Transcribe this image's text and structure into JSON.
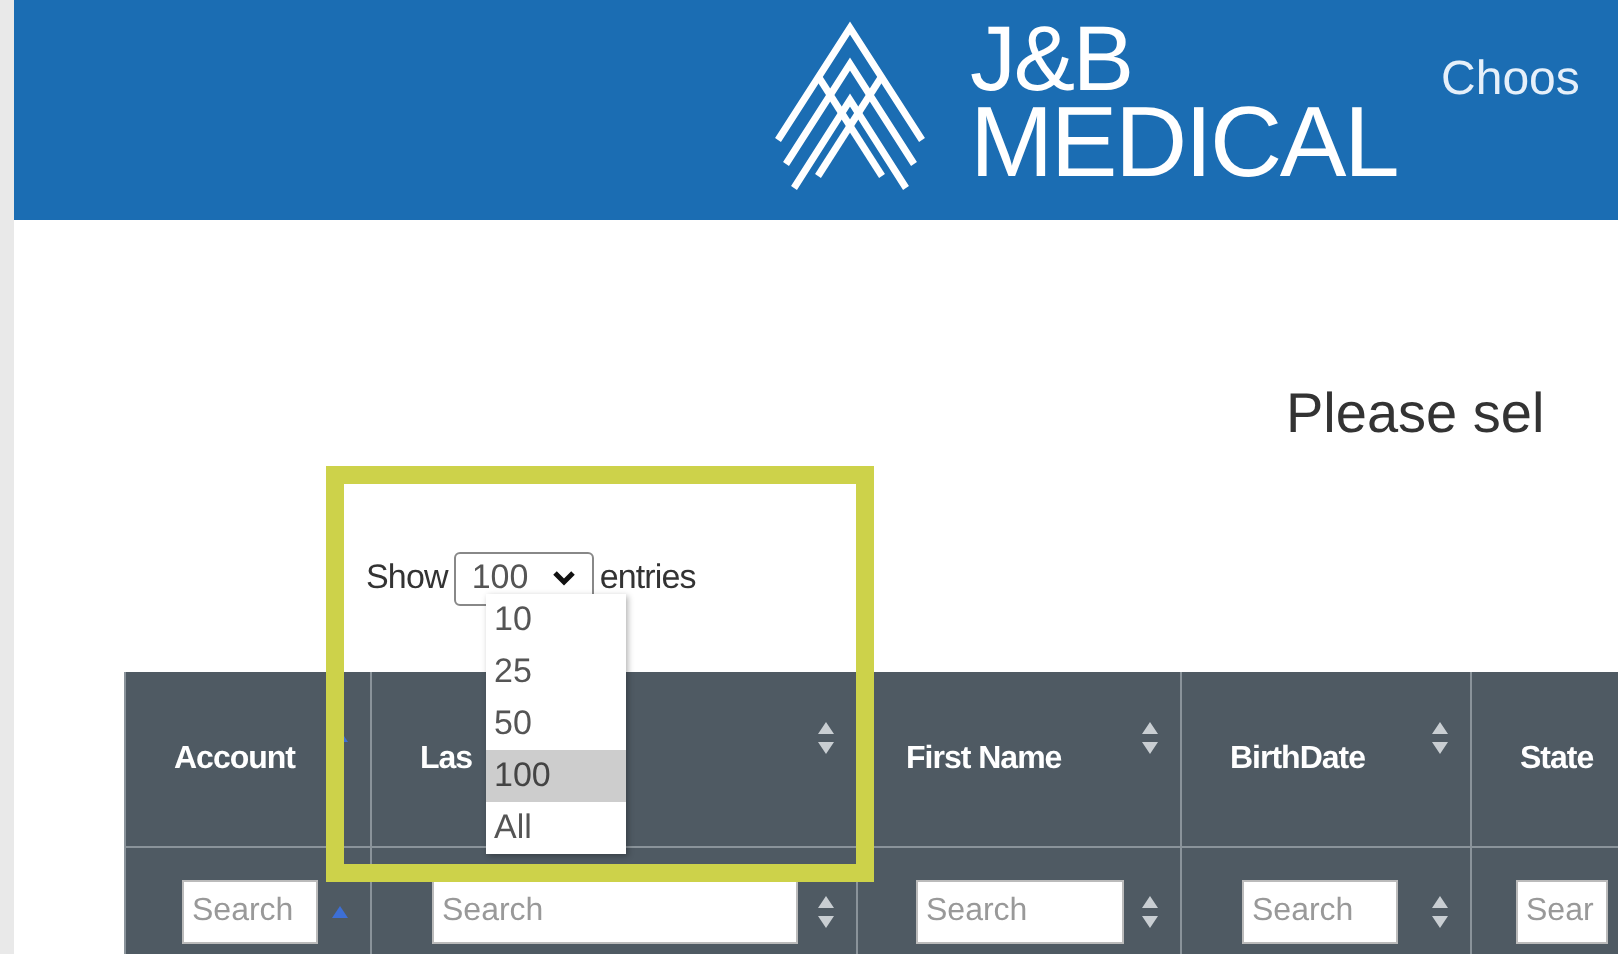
{
  "header": {
    "logo_top": "J&B",
    "logo_bottom": "MEDICAL",
    "nav_text": "Choos"
  },
  "prompt": "Please sel",
  "length_control": {
    "label_before": "Show",
    "value": "100",
    "label_after": "entries",
    "expanded": true,
    "options": [
      {
        "label": "10",
        "selected": false
      },
      {
        "label": "25",
        "selected": false
      },
      {
        "label": "50",
        "selected": false
      },
      {
        "label": "100",
        "selected": true
      },
      {
        "label": "All",
        "selected": false
      }
    ]
  },
  "table": {
    "columns": [
      {
        "label": "Account",
        "sorted": true,
        "search_placeholder": "Search"
      },
      {
        "label": "Las",
        "sorted": false,
        "search_placeholder": "Search"
      },
      {
        "label": "First Name",
        "sorted": false,
        "search_placeholder": "Search"
      },
      {
        "label": "BirthDate",
        "sorted": false,
        "search_placeholder": "Search"
      },
      {
        "label": "State",
        "search_placeholder": "Sear"
      }
    ]
  }
}
